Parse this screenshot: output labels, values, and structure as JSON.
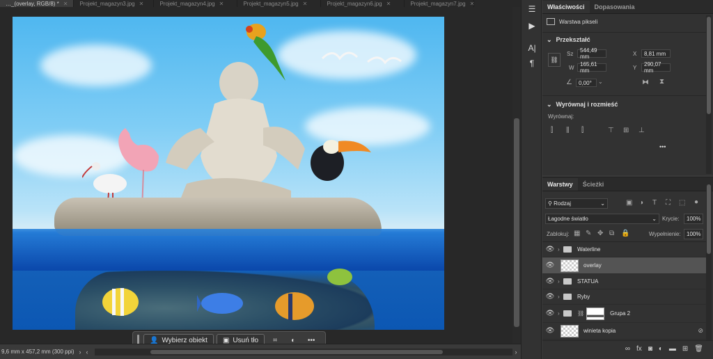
{
  "tabs": [
    {
      "label": "…_(overlay, RGB/8) *",
      "active": true
    },
    {
      "label": "Projekt_magazyn3.jpg",
      "active": false
    },
    {
      "label": "Projekt_magazyn4.jpg",
      "active": false
    },
    {
      "label": "Projekt_magazyn5.jpg",
      "active": false
    },
    {
      "label": "Projekt_magazyn6.jpg",
      "active": false
    },
    {
      "label": "Projekt_magazyn7.jpg",
      "active": false
    }
  ],
  "context_bar": {
    "select_subject": "Wybierz obiekt",
    "remove_bg": "Usuń tło",
    "more": "•••"
  },
  "status": {
    "doc_size": "9,6 mm x 457,2 mm (300 ppi)"
  },
  "properties": {
    "tabs": [
      "Właściwości",
      "Dopasowania"
    ],
    "layer_type": "Warstwa pikseli",
    "transform": {
      "title": "Przekształć",
      "w_label": "Sz",
      "w_value": "544,49 mm",
      "h_label": "W",
      "h_value": "165,61 mm",
      "x_label": "X",
      "x_value": "8,81 mm",
      "y_label": "Y",
      "y_value": "290,07 mm",
      "angle_value": "0,00°"
    },
    "align": {
      "title": "Wyrównaj i rozmieść",
      "align_label": "Wyrównaj:",
      "more": "•••"
    }
  },
  "layers": {
    "tabs": [
      "Warstwy",
      "Ścieżki"
    ],
    "filter_kind": "Rodzaj",
    "blend_mode": "Łagodne światło",
    "opacity_label": "Krycie:",
    "opacity_value": "100%",
    "lock_label": "Zablokuj:",
    "fill_label": "Wypełnienie:",
    "fill_value": "100%",
    "items": [
      {
        "name": "Waterline",
        "kind": "group",
        "selected": false
      },
      {
        "name": "overlay",
        "kind": "pixel",
        "selected": true
      },
      {
        "name": "STATUA",
        "kind": "group",
        "selected": false
      },
      {
        "name": "Ryby",
        "kind": "group",
        "selected": false
      },
      {
        "name": "Grupa 2",
        "kind": "group-mask",
        "selected": false
      },
      {
        "name": "winieta kopia",
        "kind": "pixel-smart",
        "selected": false
      }
    ]
  }
}
